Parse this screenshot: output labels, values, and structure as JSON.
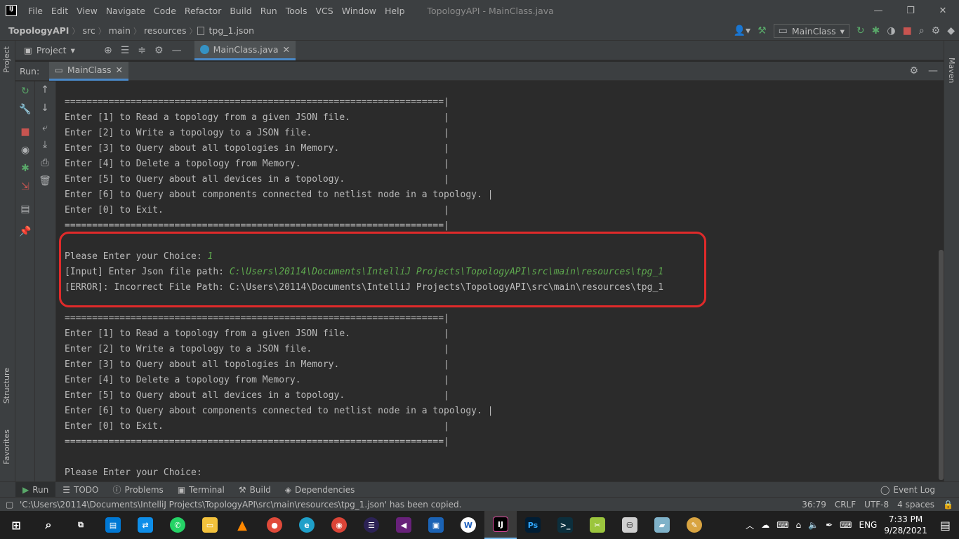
{
  "window": {
    "logo": "IJ",
    "menu": [
      "File",
      "Edit",
      "View",
      "Navigate",
      "Code",
      "Refactor",
      "Build",
      "Run",
      "Tools",
      "VCS",
      "Window",
      "Help"
    ],
    "title": "TopologyAPI - MainClass.java",
    "controls": [
      "—",
      "❐",
      "✕"
    ]
  },
  "breadcrumb": [
    "TopologyAPI",
    "src",
    "main",
    "resources",
    "tpg_1.json"
  ],
  "run_config": "MainClass",
  "left_stripe": {
    "project": "Project",
    "structure": "Structure",
    "favorites": "Favorites"
  },
  "right_stripe": {
    "maven": "Maven"
  },
  "project_panel": {
    "label": "Project"
  },
  "editor_tab": {
    "label": "MainClass.java"
  },
  "run_panel": {
    "label": "Run:",
    "tab": "MainClass"
  },
  "console": {
    "lines": [
      "=====================================================================|",
      "Enter [1] to Read a topology from a given JSON file.                 |",
      "Enter [2] to Write a topology to a JSON file.                        |",
      "Enter [3] to Query about all topologies in Memory.                   |",
      "Enter [4] to Delete a topology from Memory.                          |",
      "Enter [5] to Query about all devices in a topology.                  |",
      "Enter [6] to Query about components connected to netlist node in a topology. |",
      "Enter [0] to Exit.                                                   |",
      "=====================================================================|",
      "",
      "Please Enter your Choice: ",
      "[Input] Enter Json file path: ",
      "[ERROR]: Incorrect File Path: C:\\Users\\20114\\Documents\\IntelliJ Projects\\TopologyAPI\\src\\main\\resources\\tpg_1",
      "",
      "=====================================================================|",
      "Enter [1] to Read a topology from a given JSON file.                 |",
      "Enter [2] to Write a topology to a JSON file.                        |",
      "Enter [3] to Query about all topologies in Memory.                   |",
      "Enter [4] to Delete a topology from Memory.                          |",
      "Enter [5] to Query about all devices in a topology.                  |",
      "Enter [6] to Query about components connected to netlist node in a topology. |",
      "Enter [0] to Exit.                                                   |",
      "=====================================================================|",
      "",
      "Please Enter your Choice: "
    ],
    "user_choice": "1",
    "user_path": "C:\\Users\\20114\\Documents\\IntelliJ Projects\\TopologyAPI\\src\\main\\resources\\tpg_1"
  },
  "bottom_tabs": [
    "Run",
    "TODO",
    "Problems",
    "Terminal",
    "Build",
    "Dependencies"
  ],
  "event_log": "Event Log",
  "status": {
    "message": "'C:\\Users\\20114\\Documents\\IntelliJ Projects\\TopologyAPI\\src\\main\\resources\\tpg_1.json' has been copied.",
    "position": "36:79",
    "line_sep": "CRLF",
    "encoding": "UTF-8",
    "indent": "4 spaces"
  },
  "taskbar": {
    "lang": "ENG",
    "time": "7:33 PM",
    "date": "9/28/2021"
  }
}
